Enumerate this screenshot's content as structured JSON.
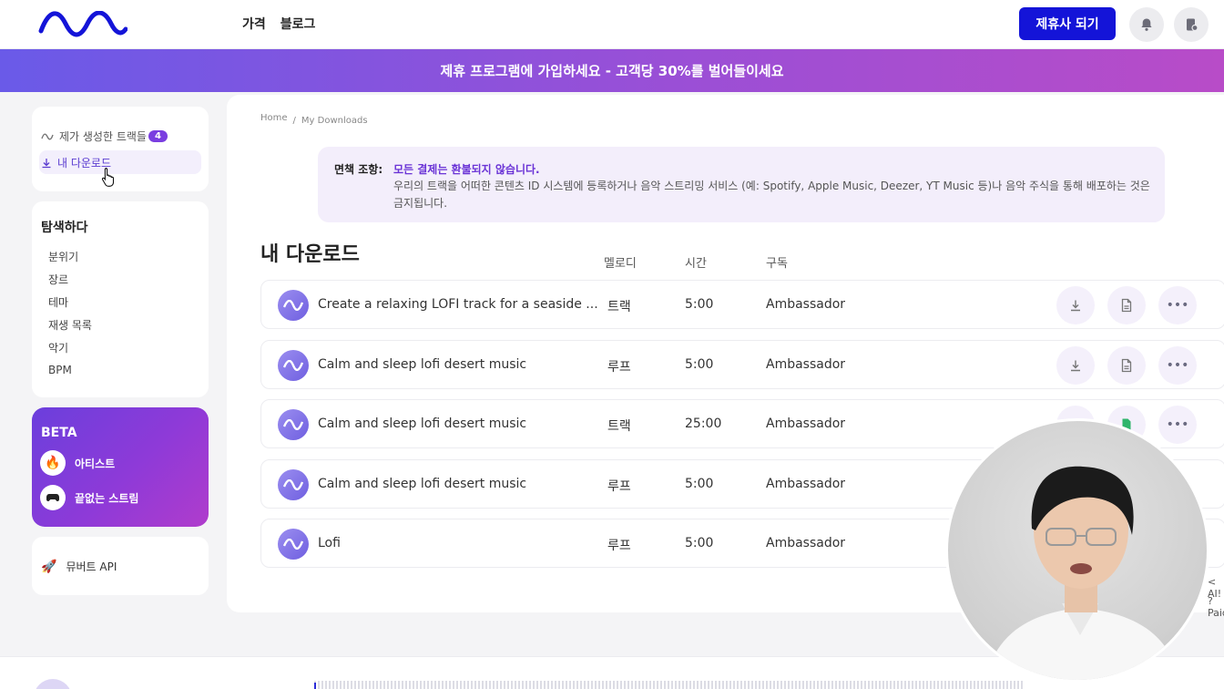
{
  "header": {
    "nav": [
      "가격",
      "블로그"
    ],
    "cta_label": "제휴사 되기",
    "icons": [
      "bell-icon",
      "account-icon"
    ]
  },
  "banner": {
    "text": "제휴 프로그램에 가입하세요 - 고객당 30%를 벌어들이세요"
  },
  "sidebar": {
    "my_tracks": {
      "label": "제가 생성한 트랙들",
      "count": "4"
    },
    "my_downloads": {
      "label": "내 다운로드"
    },
    "explore": {
      "title": "탐색하다",
      "items": [
        "분위기",
        "장르",
        "테마",
        "재생 목록",
        "악기",
        "BPM"
      ]
    },
    "beta": {
      "title": "BETA",
      "items": [
        {
          "label": "아티스트",
          "icon": "fire-icon"
        },
        {
          "label": "끝없는 스트림",
          "icon": "gamepad-icon"
        }
      ]
    },
    "api": {
      "label": "뮤버트 API",
      "icon": "rocket-icon"
    }
  },
  "breadcrumb": [
    "Home",
    "/",
    "My Downloads"
  ],
  "notice": {
    "label": "면책 조항:",
    "headline": "모든 결제는 환불되지 않습니다.",
    "body": "우리의 트랙을 어떠한 콘텐츠 ID 시스템에 등록하거나 음악 스트리밍 서비스 (예: Spotify, Apple Music, Deezer, YT Music 등)나 음악 주식을 통해 배포하는 것은 금지됩니다."
  },
  "downloads": {
    "title": "내 다운로드",
    "columns": [
      "멜로디",
      "시간",
      "구독"
    ],
    "rows": [
      {
        "title": "Create a relaxing LOFI track for a seaside ...",
        "type": "트랙",
        "time": "5:00",
        "plan": "Ambassador"
      },
      {
        "title": "Calm and sleep lofi desert music",
        "type": "루프",
        "time": "5:00",
        "plan": "Ambassador"
      },
      {
        "title": "Calm and sleep lofi desert music",
        "type": "트랙",
        "time": "25:00",
        "plan": "Ambassador"
      },
      {
        "title": "Calm and sleep lofi desert music",
        "type": "루프",
        "time": "5:00",
        "plan": "Ambassador"
      },
      {
        "title": "Lofi",
        "type": "루프",
        "time": "5:00",
        "plan": "Ambassador"
      }
    ]
  },
  "side_peek": [
    "< AI!",
    "? Paid"
  ],
  "colors": {
    "accent": "#1414d8",
    "purple": "#7a3ee0",
    "banner_start": "#6a5ae8",
    "banner_end": "#b84cc8"
  }
}
